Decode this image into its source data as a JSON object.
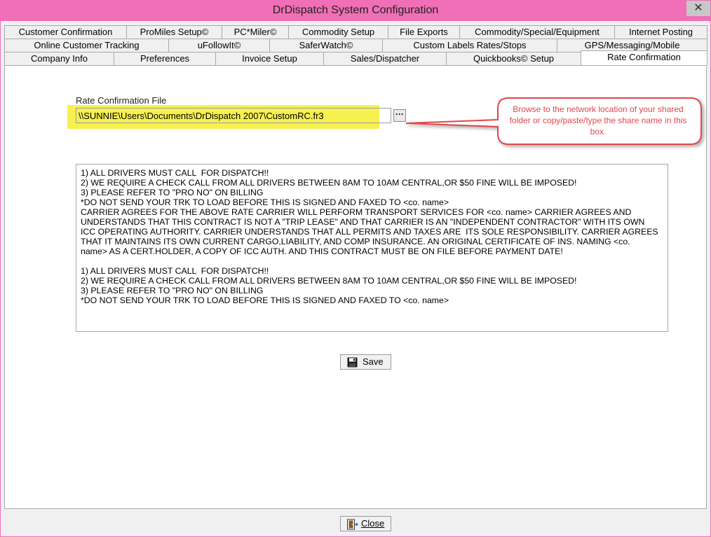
{
  "window": {
    "title": "DrDispatch  System Configuration",
    "close_glyph": "✕"
  },
  "tabs": {
    "row1": [
      "Customer Confirmation",
      "ProMiles Setup©",
      "PC*Miler©",
      "Commodity Setup",
      "File Exports",
      "Commodity/Special/Equipment",
      "Internet Posting"
    ],
    "row2": [
      "Online Customer Tracking",
      "uFollowIt©",
      "SaferWatch©",
      "Custom Labels Rates/Stops",
      "GPS/Messaging/Mobile"
    ],
    "row3": [
      "Company Info",
      "Preferences",
      "Invoice Setup",
      "Sales/Dispatcher",
      "Quickbooks© Setup",
      "Rate Confirmation"
    ]
  },
  "rate_confirmation": {
    "file_label": "Rate Confirmation File",
    "file_path": "\\\\SUNNIE\\Users\\Documents\\DrDispatch 2007\\CustomRC.fr3",
    "browse_label": "···",
    "callout": "Browse to the network location of your shared folder or copy/paste/type the share name in this box.",
    "callout_color": "#e0474c",
    "highlight_color": "#f6f14e",
    "memo_text": "1) ALL DRIVERS MUST CALL  FOR DISPATCH!!\n2) WE REQUIRE A CHECK CALL FROM ALL DRIVERS BETWEEN 8AM TO 10AM CENTRAL,OR $50 FINE WILL BE IMPOSED!\n3) PLEASE REFER TO \"PRO NO\" ON BILLING\n*DO NOT SEND YOUR TRK TO LOAD BEFORE THIS IS SIGNED AND FAXED TO <co. name>\nCARRIER AGREES FOR THE ABOVE RATE CARRIER WILL PERFORM TRANSPORT SERVICES FOR <co. name> CARRIER AGREES AND\nUNDERSTANDS THAT THIS CONTRACT IS NOT A \"TRIP LEASE\" AND THAT CARRIER IS AN \"INDEPENDENT CONTRACTOR\" WITH ITS OWN\nICC OPERATING AUTHORITY. CARRIER UNDERSTANDS THAT ALL PERMITS AND TAXES ARE  ITS SOLE RESPONSIBILITY. CARRIER AGREES\nTHAT IT MAINTAINS ITS OWN CURRENT CARGO,LIABILITY, AND COMP INSURANCE. AN ORIGINAL CERTIFICATE OF INS. NAMING <co.\nname> AS A CERT.HOLDER, A COPY OF ICC AUTH. AND THIS CONTRACT MUST BE ON FILE BEFORE PAYMENT DATE!\n\n1) ALL DRIVERS MUST CALL  FOR DISPATCH!!\n2) WE REQUIRE A CHECK CALL FROM ALL DRIVERS BETWEEN 8AM TO 10AM CENTRAL,OR $50 FINE WILL BE IMPOSED!\n3) PLEASE REFER TO \"PRO NO\" ON BILLING\n*DO NOT SEND YOUR TRK TO LOAD BEFORE THIS IS SIGNED AND FAXED TO <co. name>",
    "save_label": "Save"
  },
  "footer": {
    "close_label": "Close"
  },
  "colors": {
    "titlebar": "#f06fb6",
    "callout": "#e0474c",
    "highlight": "#f6f14e"
  }
}
